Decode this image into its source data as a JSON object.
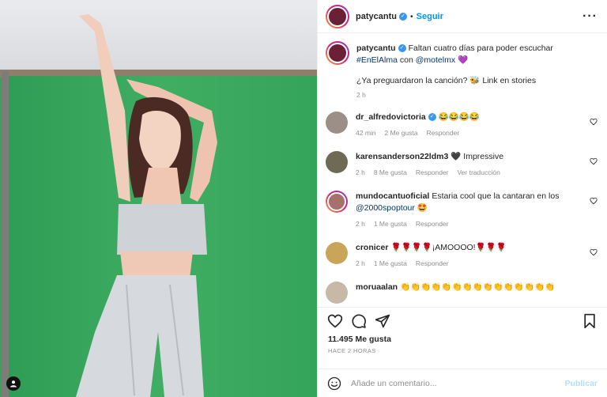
{
  "post": {
    "username": "patycantu",
    "follow_label": "Seguir",
    "caption_line1": "Faltan cuatro días para poder escuchar",
    "caption_hashtag": "#EnElAlma",
    "caption_con": "con",
    "caption_mention": "@motelmx",
    "caption_emoji": "💜",
    "caption_line2": "¿Ya preguardaron la canción? 🐝 Link en stories",
    "caption_time": "2 h"
  },
  "comments": [
    {
      "user": "dr_alfredovictoria",
      "text": "😂😂😂😂",
      "time": "42 min",
      "likes": "2 Me gusta",
      "reply": "Responder"
    },
    {
      "user": "karensanderson22ldm3",
      "text": "🖤 Impressive",
      "time": "2 h",
      "likes": "8 Me gusta",
      "reply": "Responder",
      "translate": "Ver traducción"
    },
    {
      "user": "mundocantuoficial",
      "text": "Estaria cool que la cantaran en los",
      "mention": "@2000spoptour",
      "emoji": "🤩",
      "time": "2 h",
      "likes": "1 Me gusta",
      "reply": "Responder"
    },
    {
      "user": "cronicer",
      "text": "🌹🌹🌹🌹¡AMOOOO!🌹🌹🌹",
      "time": "2 h",
      "likes": "1 Me gusta",
      "reply": "Responder"
    },
    {
      "user": "moruaalan",
      "text": "👏👏👏👏👏👏👏👏👏👏👏👏👏👏👏"
    }
  ],
  "actions": {
    "likes_count": "11.495 Me gusta",
    "posted_ago": "HACE 2 HORAS",
    "comment_placeholder": "Añade un comentario...",
    "publish_label": "Publicar"
  },
  "colors": {
    "link_blue": "#0095f6",
    "mention_blue": "#00376b",
    "muted": "#8e8e8e"
  }
}
